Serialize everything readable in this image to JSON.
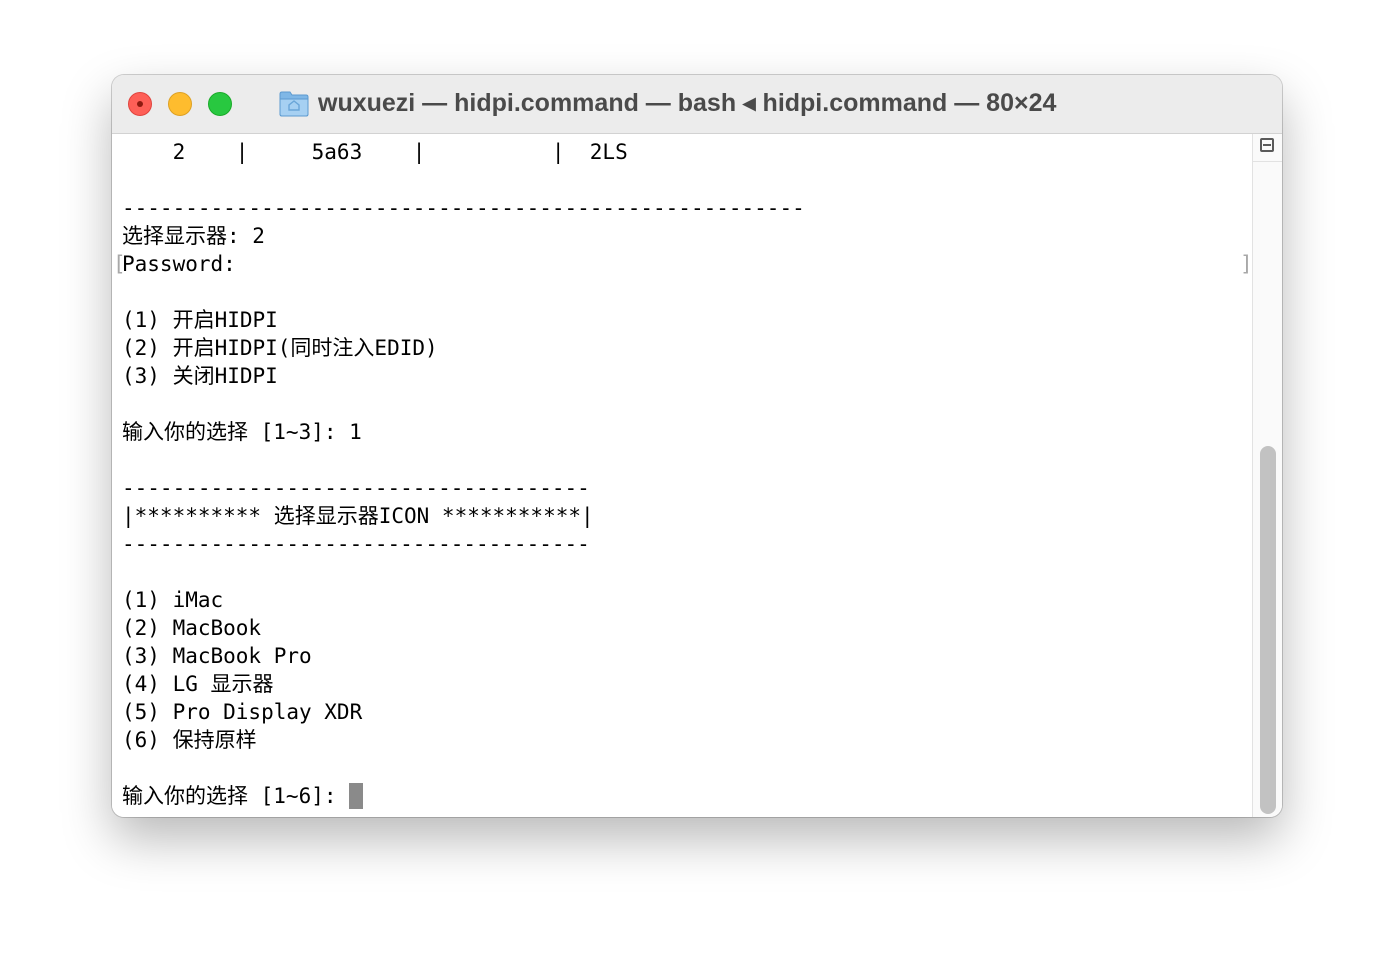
{
  "window": {
    "title": "wuxuezi — hidpi.command — bash ◂ hidpi.command — 80×24",
    "folder_icon": "folder-icon",
    "traffic_lights": {
      "close_color": "#fe5f57",
      "minimize_color": "#febc2e",
      "maximize_color": "#28c840"
    }
  },
  "terminal": {
    "lines": [
      "    2    |     5a63    |          |  2LS",
      "",
      "------------------------------------------------------",
      "选择显示器: 2",
      "Password:",
      "",
      "(1) 开启HIDPI",
      "(2) 开启HIDPI(同时注入EDID)",
      "(3) 关闭HIDPI",
      "",
      "输入你的选择 [1~3]: 1",
      "",
      "-------------------------------------",
      "|********** 选择显示器ICON ***********|",
      "-------------------------------------",
      "",
      "(1) iMac",
      "(2) MacBook",
      "(3) MacBook Pro",
      "(4) LG 显示器",
      "(5) Pro Display XDR",
      "(6) 保持原样",
      "",
      "输入你的选择 [1~6]: "
    ],
    "password_marks": [
      "[",
      "]"
    ],
    "cursor_color": "#8a8a8a"
  },
  "scrollbar": {
    "split_icon": "split-pane-icon"
  }
}
